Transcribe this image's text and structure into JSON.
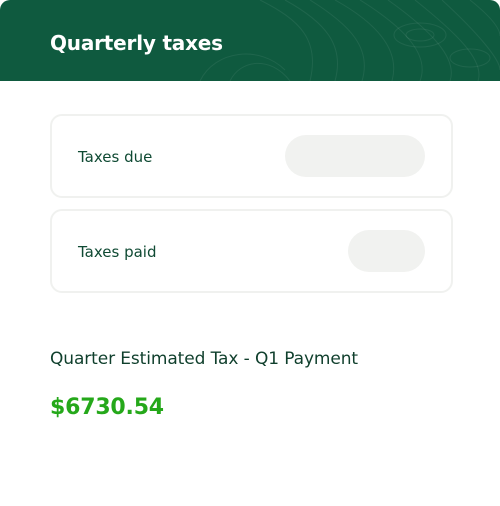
{
  "header": {
    "title": "Quarterly taxes",
    "background_color": "#0f5a3f"
  },
  "rows": [
    {
      "label": "Taxes due",
      "value_state": "loading-placeholder"
    },
    {
      "label": "Taxes paid",
      "value_state": "loading-placeholder"
    }
  ],
  "estimate": {
    "label": "Quarter Estimated Tax - Q1 Payment",
    "amount": "$6730.54",
    "amount_color": "#25a81a"
  }
}
